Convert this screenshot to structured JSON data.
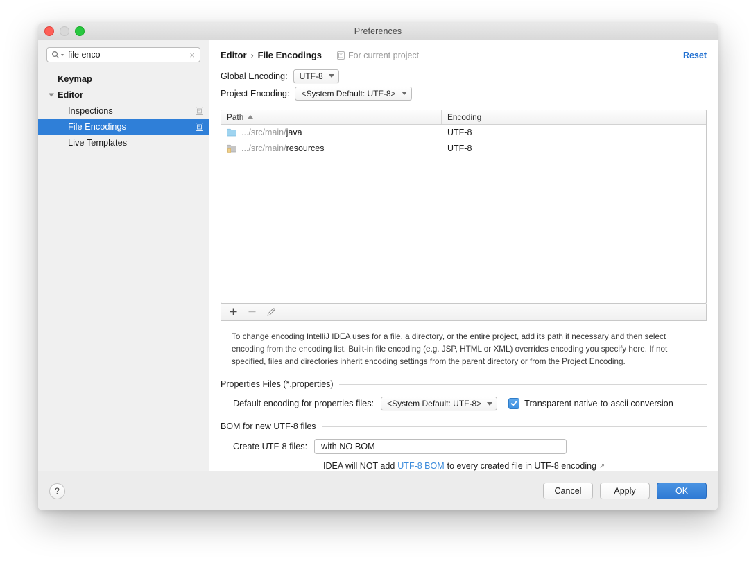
{
  "window": {
    "title": "Preferences",
    "traffic_lights": [
      "close",
      "minimize",
      "zoom"
    ]
  },
  "sidebar": {
    "search": {
      "value": "file enco",
      "placeholder": "",
      "clear_label": "×"
    },
    "items": [
      {
        "label": "Keymap",
        "level": 0,
        "bold": true,
        "toggle": false,
        "selected": false,
        "badge": false
      },
      {
        "label": "Editor",
        "level": 0,
        "bold": true,
        "toggle": true,
        "selected": false,
        "badge": false
      },
      {
        "label": "Inspections",
        "level": 1,
        "bold": false,
        "toggle": false,
        "selected": false,
        "badge": true
      },
      {
        "label": "File Encodings",
        "level": 1,
        "bold": false,
        "toggle": false,
        "selected": true,
        "badge": true
      },
      {
        "label": "Live Templates",
        "level": 1,
        "bold": false,
        "toggle": false,
        "selected": false,
        "badge": false
      }
    ]
  },
  "main": {
    "breadcrumb": {
      "parent": "Editor",
      "separator": "›",
      "current": "File Encodings"
    },
    "for_current_project": "For current project",
    "reset_label": "Reset",
    "global_encoding": {
      "label": "Global Encoding:",
      "value": "UTF-8"
    },
    "project_encoding": {
      "label": "Project Encoding:",
      "value": "<System Default: UTF-8>"
    },
    "table": {
      "columns": [
        "Path",
        "Encoding"
      ],
      "sort_column": "Path",
      "sort_direction": "ascending",
      "rows": [
        {
          "path_prefix": ".../src/main/",
          "path_name": "java",
          "icon": "source-folder-icon",
          "encoding": "UTF-8"
        },
        {
          "path_prefix": ".../src/main/",
          "path_name": "resources",
          "icon": "resource-folder-icon",
          "encoding": "UTF-8"
        }
      ]
    },
    "table_toolbar": [
      {
        "name": "add-button",
        "glyph": "+",
        "enabled": true
      },
      {
        "name": "remove-button",
        "glyph": "−",
        "enabled": false
      },
      {
        "name": "edit-button",
        "glyph": "pencil",
        "enabled": true
      }
    ],
    "help_text": "To change encoding IntelliJ IDEA uses for a file, a directory, or the entire project, add its path if necessary and then select encoding from the encoding list. Built-in file encoding (e.g. JSP, HTML or XML) overrides encoding you specify here. If not specified, files and directories inherit encoding settings from the parent directory or from the Project Encoding.",
    "properties_section": {
      "title": "Properties Files (*.properties)",
      "default_encoding_label": "Default encoding for properties files:",
      "default_encoding_value": "<System Default: UTF-8>",
      "transparent_checkbox_label": "Transparent native-to-ascii conversion",
      "transparent_checked": true
    },
    "bom_section": {
      "title": "BOM for new UTF-8 files",
      "create_label": "Create UTF-8 files:",
      "create_value": "with NO BOM",
      "note_before": "IDEA will NOT add",
      "note_link": "UTF-8 BOM",
      "note_after": "to every created file in UTF-8 encoding",
      "note_arrow": "↗"
    }
  },
  "footer": {
    "help_label": "?",
    "cancel_label": "Cancel",
    "apply_label": "Apply",
    "ok_label": "OK"
  },
  "colors": {
    "selection_blue": "#2f7fd8",
    "link_blue": "#3b8bdc",
    "reset_blue": "#1f6fd0",
    "primary_button": "#2f7ad4",
    "source_folder": "#9fd4f0",
    "resource_folder": "#c3c3c3"
  }
}
